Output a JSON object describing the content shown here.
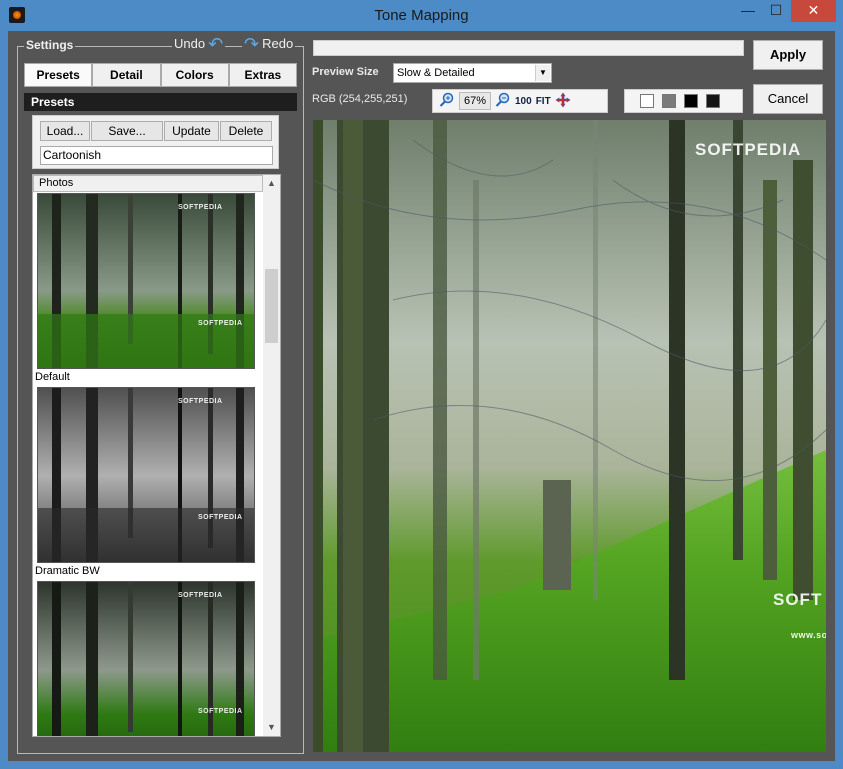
{
  "window": {
    "title": "Tone Mapping",
    "min_label": "—",
    "max_label": "☐",
    "close_label": "✕"
  },
  "settings": {
    "legend": "Settings",
    "undo_label": "Undo",
    "redo_label": "Redo",
    "tabs": [
      {
        "label": "Presets"
      },
      {
        "label": "Detail"
      },
      {
        "label": "Colors"
      },
      {
        "label": "Extras"
      }
    ],
    "presets_header": "Presets",
    "buttons": {
      "load": "Load...",
      "save": "Save...",
      "update": "Update",
      "delete": "Delete"
    },
    "preset_name_value": "Cartoonish",
    "list": {
      "header": "Photos",
      "items": [
        {
          "label": "Default"
        },
        {
          "label": "Dramatic BW"
        }
      ]
    },
    "watermark": "SOFTPEDIA"
  },
  "preview_controls": {
    "preview_size_label": "Preview Size",
    "preview_size_value": "Slow & Detailed",
    "rgb_readout": "RGB (254,255,251)",
    "zoom_value": "67%",
    "zoom_100_label": "100",
    "zoom_fit_label": "FIT",
    "swatches": [
      "#ffffff",
      "#7a7a7a",
      "#000000",
      "#151515"
    ]
  },
  "actions": {
    "apply": "Apply",
    "cancel": "Cancel"
  },
  "preview": {
    "watermark": "SOFTPEDIA",
    "watermark2": "SOFT",
    "watermark_url": "www.sof"
  },
  "colors": {
    "titlebar": "#4d8bc6",
    "panel": "#555555",
    "close": "#c7493c",
    "accent_icon": "#5fa8e6"
  }
}
